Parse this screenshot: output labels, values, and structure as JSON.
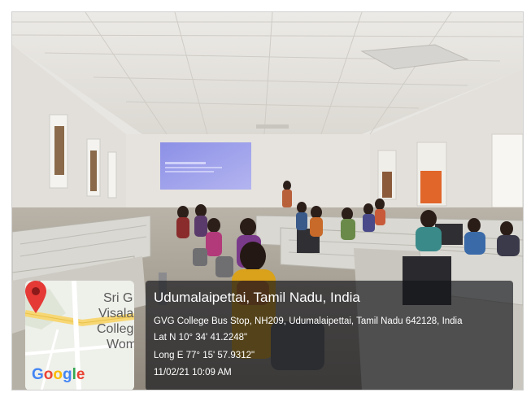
{
  "map": {
    "labels": [
      "Sri G",
      "Visala",
      "Colleg",
      "Wom"
    ],
    "logo_letters": [
      {
        "char": "G",
        "color": "#4285F4"
      },
      {
        "char": "o",
        "color": "#EA4335"
      },
      {
        "char": "o",
        "color": "#FBBC05"
      },
      {
        "char": "g",
        "color": "#4285F4"
      },
      {
        "char": "l",
        "color": "#34A853"
      },
      {
        "char": "e",
        "color": "#EA4335"
      }
    ],
    "pin_color": "#E53935"
  },
  "location": {
    "title": "Udumalaipettai, Tamil Nadu, India",
    "address": "GVG College Bus Stop, NH209, Udumalaipettai, Tamil Nadu 642128, India",
    "latitude": "Lat N 10° 34' 41.2248\"",
    "longitude": "Long E 77° 15' 57.9312\"",
    "datetime": "11/02/21 10:09 AM"
  }
}
